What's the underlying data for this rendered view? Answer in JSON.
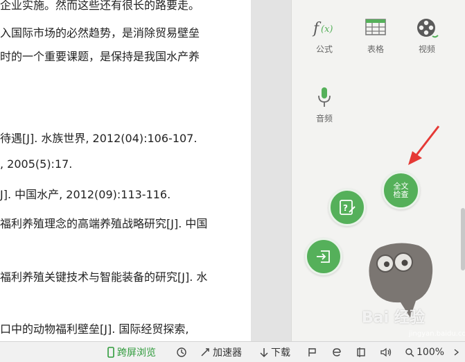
{
  "document": {
    "lines": [
      "企业实施。然而这些还有很长的路要走。",
      "入国际市场的必然趋势，是消除贸易壁垒",
      "时的一个重要课题，是保持是我国水产养",
      "待遇[J]. 水族世界, 2012(04):106-107.",
      ", 2005(5):17.",
      "J]. 中国水产, 2012(09):113-116.",
      "福利养殖理念的高端养殖战略研究[J]. 中国",
      "福利养殖关键技术与智能装备的研究[J]. 水",
      "口中的动物福利壁垒[J]. 国际经贸探索,"
    ]
  },
  "panel": {
    "tools": [
      {
        "label": "公式",
        "icon": "formula-icon"
      },
      {
        "label": "表格",
        "icon": "table-icon"
      },
      {
        "label": "视频",
        "icon": "video-icon"
      },
      {
        "label": "音频",
        "icon": "microphone-icon"
      }
    ],
    "fab_check_label": "全文检查",
    "fab_check_line1": "全文",
    "fab_check_line2": "检查"
  },
  "status_bar": {
    "cross_screen": "跨屏浏览",
    "accelerator": "加速器",
    "download": "下载",
    "zoom": "100%"
  },
  "watermark": {
    "main": "Bai 经验",
    "sub": "jingyan.baidu.com"
  },
  "colors": {
    "accent_green": "#55b05a",
    "arrow_red": "#e53935",
    "panel_bg": "#f3f3f1"
  }
}
